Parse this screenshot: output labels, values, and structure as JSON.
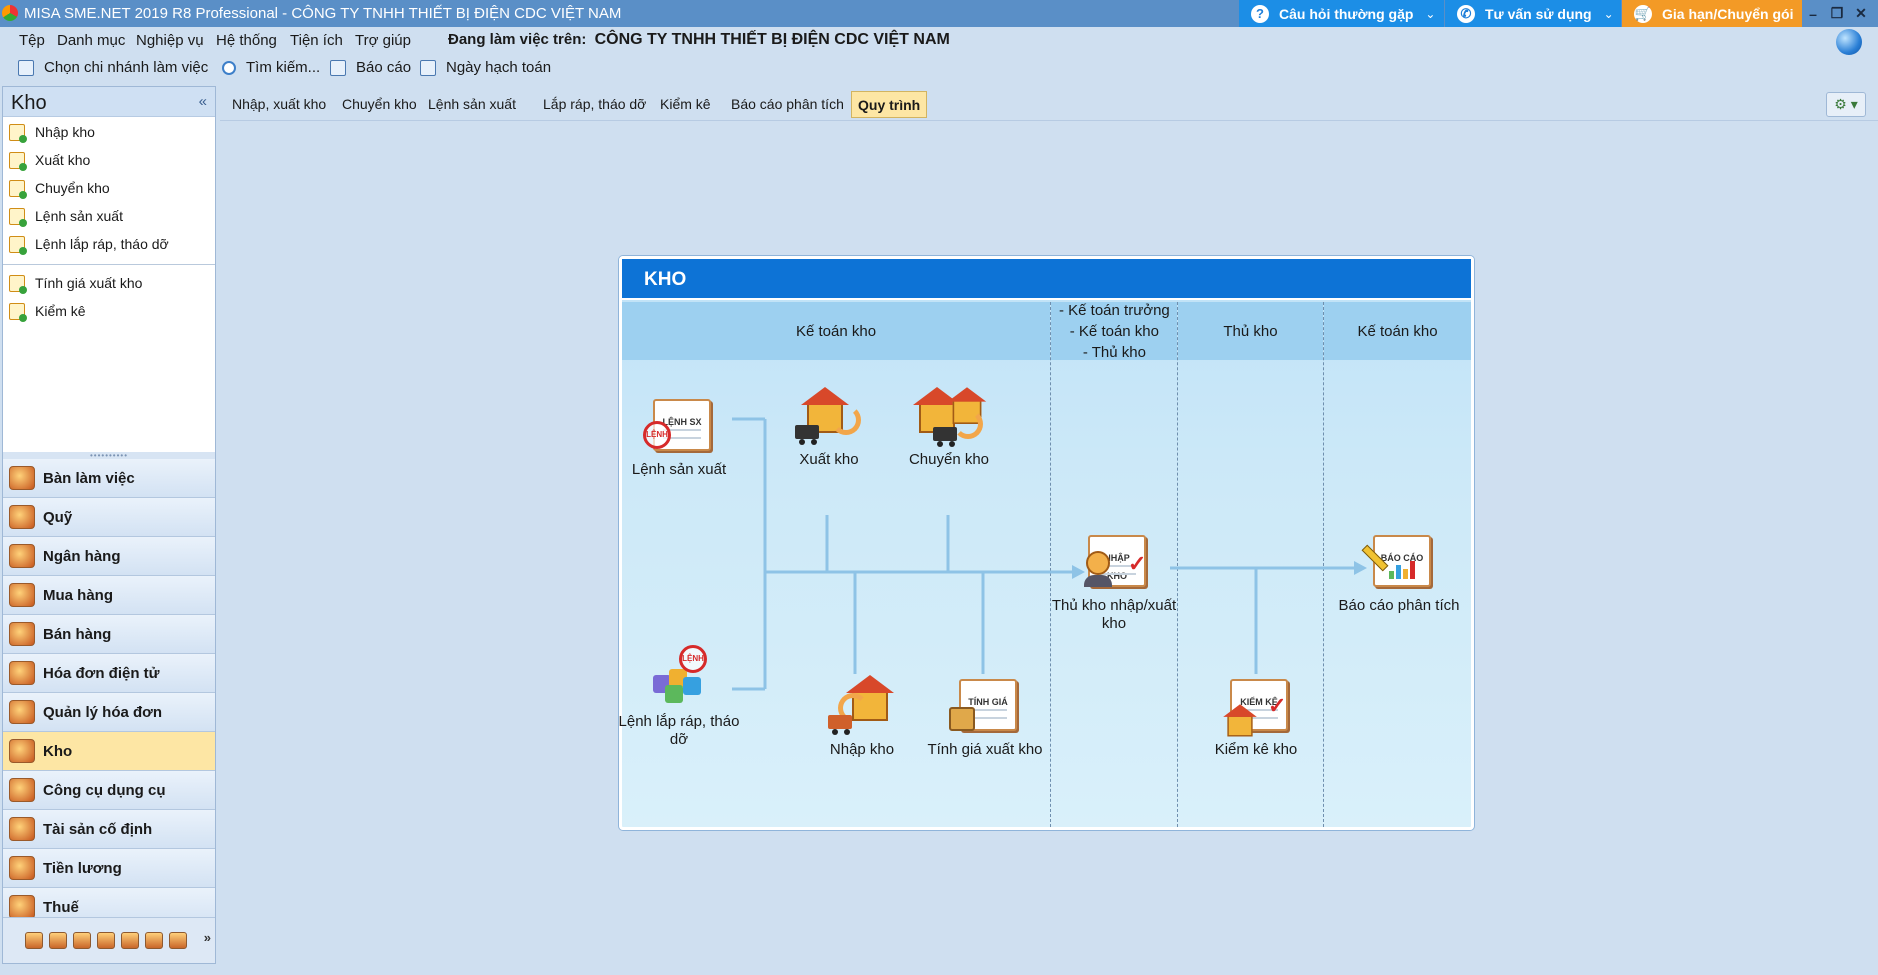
{
  "titlebar": {
    "title": "MISA SME.NET 2019 R8 Professional - CÔNG TY TNHH THIẾT BỊ ĐIỆN CDC VIỆT NAM",
    "faq": "Câu hỏi thường gặp",
    "consult": "Tư vấn sử dụng",
    "renew": "Gia hạn/Chuyển gói",
    "faq_icon": "?",
    "minimize": "–",
    "restore": "❐",
    "close": "✕"
  },
  "menu": {
    "items": [
      "Tệp",
      "Danh mục",
      "Nghiệp vụ",
      "Hệ thống",
      "Tiện ích",
      "Trợ giúp"
    ],
    "working_on_label": "Đang làm việc trên:",
    "company": "CÔNG TY TNHH THIẾT BỊ ĐIỆN CDC VIỆT NAM"
  },
  "toolbar": {
    "branch": "Chọn chi nhánh làm việc",
    "search": "Tìm kiếm...",
    "report": "Báo cáo",
    "posting_date": "Ngày hạch toán"
  },
  "nav": {
    "title": "Kho",
    "collapse": "«",
    "links": [
      "Nhập kho",
      "Xuất kho",
      "Chuyển kho",
      "Lệnh sản xuất",
      "Lệnh lắp ráp, tháo dỡ"
    ],
    "links2": [
      "Tính giá xuất kho",
      "Kiểm kê"
    ],
    "splitter": "••••••••••",
    "modules": [
      "Bàn làm việc",
      "Quỹ",
      "Ngân hàng",
      "Mua hàng",
      "Bán hàng",
      "Hóa đơn điện tử",
      "Quản lý hóa đơn",
      "Kho",
      "Công cụ dụng cụ",
      "Tài sản cố định",
      "Tiền lương",
      "Thuế"
    ],
    "active_module": "Kho",
    "more": "»"
  },
  "tabs": {
    "items": [
      "Nhập, xuất kho",
      "Chuyển kho",
      "Lệnh sản xuất",
      "Lắp ráp, tháo dỡ",
      "Kiểm kê",
      "Báo cáo phân tích",
      "Quy trình"
    ],
    "active": "Quy trình",
    "gear": "⚙ ▾"
  },
  "diagram": {
    "title": "KHO",
    "lanes": {
      "l1": "Kế toán kho",
      "l2_lines": [
        "- Kế toán trưởng",
        "- Kế toán kho",
        "- Thủ kho"
      ],
      "l3": "Thủ kho",
      "l4": "Kế toán kho"
    },
    "icon_labels": {
      "lenh_sx": "LỆNH SX",
      "stamp": "LỆNH",
      "nhap_kho": "NHẬP KHO",
      "tinh_gia": "TÍNH GIÁ",
      "kiem_ke": "KIỂM KÊ",
      "bao_cao": "BÁO CÁO"
    },
    "nodes": {
      "production_order": "Lệnh sản xuất",
      "issue": "Xuất kho",
      "transfer": "Chuyển kho",
      "assembly": "Lệnh lắp ráp, tháo dỡ",
      "receipt": "Nhập kho",
      "costing": "Tính giá xuất kho",
      "storekeeper": "Thủ kho nhập/xuất kho",
      "stocktake": "Kiểm kê kho",
      "report": "Báo cáo phân tích"
    }
  },
  "colors": {
    "accent_blue": "#0d73d6",
    "active_yellow": "#fde6a4",
    "renew_orange": "#f39a26"
  }
}
